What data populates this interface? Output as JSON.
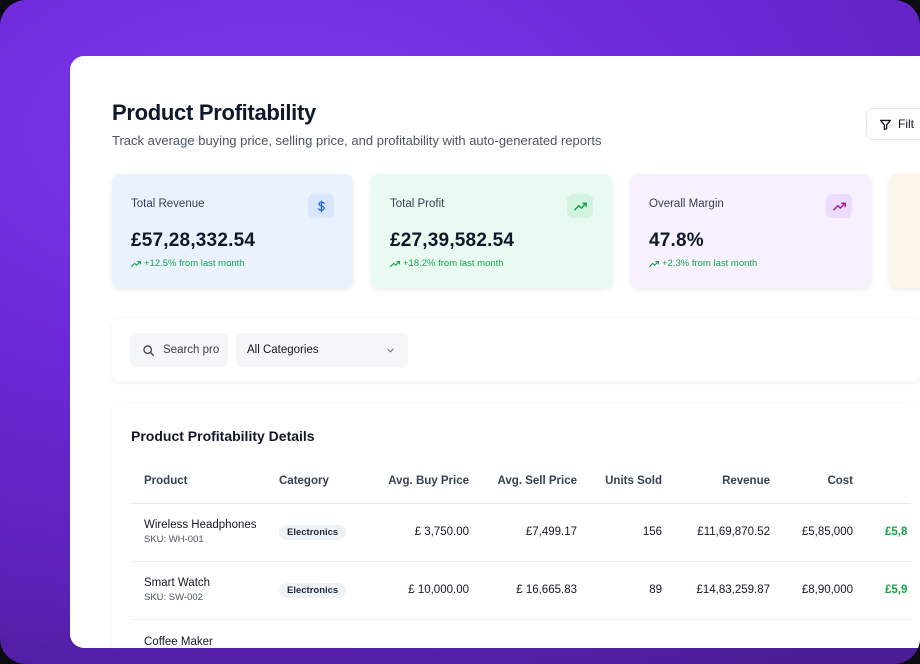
{
  "page": {
    "title": "Product Profitability",
    "subtitle": "Track average buying price, selling price, and profitability with auto-generated reports",
    "filter_label": "Filt"
  },
  "colors": {
    "background": "#6d28d9",
    "positive": "#16a34a",
    "revenue_card": "#eaf2ff",
    "profit_card": "#e9faf0",
    "margin_card": "#f7f1ff"
  },
  "cards": [
    {
      "label": "Total Revenue",
      "value": "£57,28,332.54",
      "trend": "+12.5% from last month",
      "icon": "dollar-icon"
    },
    {
      "label": "Total Profit",
      "value": "£27,39,582.54",
      "trend": "+18.2% from last month",
      "icon": "trend-up-icon"
    },
    {
      "label": "Overall Margin",
      "value": "47.8%",
      "trend": "+2.3% from last month",
      "icon": "trend-up-icon"
    }
  ],
  "toolbar": {
    "search_placeholder": "Search pro",
    "category_selected": "All Categories"
  },
  "table": {
    "title": "Product Profitability Details",
    "columns": [
      "Product",
      "Category",
      "Avg. Buy Price",
      "Avg. Sell Price",
      "Units Sold",
      "Revenue",
      "Cost"
    ],
    "rows": [
      {
        "product": "Wireless Headphones",
        "sku": "SKU: WH-001",
        "category": "Electronics",
        "buy": "£ 3,750.00",
        "sell": "£7,499.17",
        "units": "156",
        "revenue": "£11,69,870.52",
        "cost": "£5,85,000",
        "profit": "£5,8"
      },
      {
        "product": "Smart Watch",
        "sku": "SKU: SW-002",
        "category": "Electronics",
        "buy": "£ 10,000.00",
        "sell": "£ 16,665.83",
        "units": "89",
        "revenue": "£14,83,259.87",
        "cost": "£8,90,000",
        "profit": "£5,9"
      },
      {
        "product": "Coffee Maker",
        "sku": "",
        "category": "",
        "buy": "",
        "sell": "",
        "units": "",
        "revenue": "",
        "cost": "",
        "profit": ""
      }
    ]
  }
}
